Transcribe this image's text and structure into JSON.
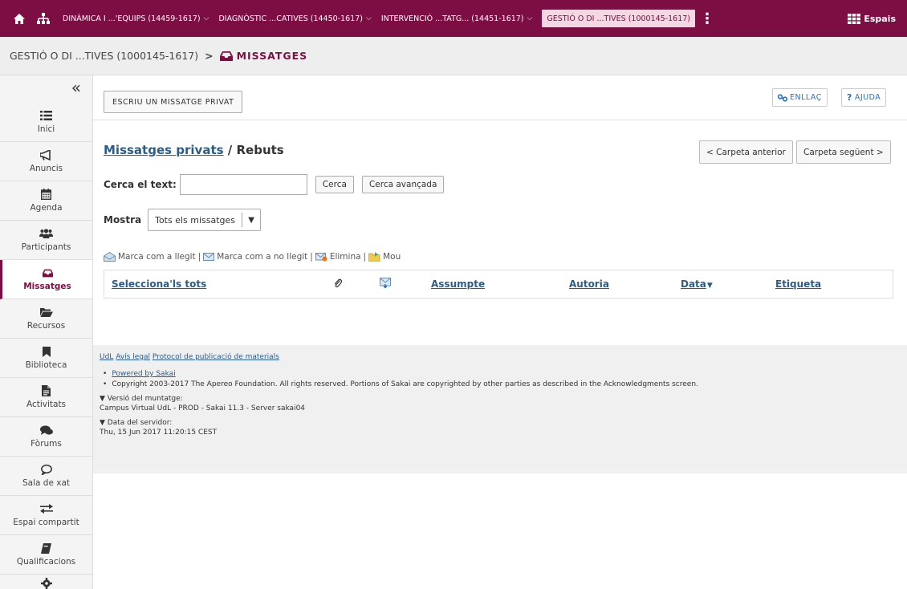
{
  "topbar": {
    "sites": [
      {
        "label": "DINÀMICA I ...'EQUIPS (14459-1617)",
        "current": false
      },
      {
        "label": "DIAGNÒSTIC ...CATIVES (14450-1617)",
        "current": false
      },
      {
        "label": "INTERVENCIÓ ...TATG... (14451-1617)",
        "current": false
      },
      {
        "label": "GESTIÓ O DI ...TIVES (1000145-1617)",
        "current": true
      }
    ],
    "espais_label": "Espais"
  },
  "breadcrumb": {
    "site": "GESTIÓ O DI ...TIVES (1000145-1617)",
    "separator": ">",
    "tool": "MISSATGES"
  },
  "sidebar": {
    "collapse_glyph": "«",
    "items": [
      {
        "label": "Inici",
        "icon": "list-icon",
        "active": false
      },
      {
        "label": "Anuncis",
        "icon": "megaphone-icon",
        "active": false
      },
      {
        "label": "Agenda",
        "icon": "calendar-icon",
        "active": false
      },
      {
        "label": "Participants",
        "icon": "users-icon",
        "active": false
      },
      {
        "label": "Missatges",
        "icon": "inbox-icon",
        "active": true
      },
      {
        "label": "Recursos",
        "icon": "folder-icon",
        "active": false
      },
      {
        "label": "Biblioteca",
        "icon": "bookmark-icon",
        "active": false
      },
      {
        "label": "Activitats",
        "icon": "file-icon",
        "active": false
      },
      {
        "label": "Fòrums",
        "icon": "comments-icon",
        "active": false
      },
      {
        "label": "Sala de xat",
        "icon": "chat-icon",
        "active": false
      },
      {
        "label": "Espai compartit",
        "icon": "exchange-icon",
        "active": false
      },
      {
        "label": "Qualificacions",
        "icon": "book-icon",
        "active": false
      }
    ]
  },
  "toolbar": {
    "write_label": "ESCRIU UN MISSATGE PRIVAT",
    "link_label": "ENLLAÇ",
    "help_label": "AJUDA"
  },
  "main": {
    "title_link": "Missatges privats",
    "title_rest": " / Rebuts",
    "prev_folder": "< Carpeta anterior",
    "next_folder": "Carpeta següent >",
    "search_label": "Cerca el text:",
    "search_value": "",
    "search_button": "Cerca",
    "advanced_button": "Cerca avançada",
    "show_label": "Mostra",
    "show_value": "Tots els missatges",
    "actions": {
      "mark_read": "Marca com a llegit",
      "mark_unread": "Marca com a no llegit",
      "delete": "Elimina",
      "move": "Mou",
      "separator": "|"
    },
    "table_headers": {
      "select_all": "Selecciona'ls tots",
      "subject": "Assumpte",
      "author": "Autoria",
      "date": "Data",
      "label": "Etiqueta"
    }
  },
  "footer": {
    "links": [
      "UdL",
      "Avís legal",
      "Protocol de publicació de materials"
    ],
    "powered": "Powered by Sakai",
    "copyright": "Copyright 2003-2017 The Apereo Foundation. All rights reserved. Portions of Sakai are copyrighted by other parties as described in the Acknowledgments screen.",
    "build_label": "▼ Versió del muntatge:",
    "build_value": "Campus Virtual UdL - PROD - Sakai 11.3 - Server sakai04",
    "server_label": "▼ Data del servidor:",
    "server_value": "Thu, 15 Jun 2017 11:20:15 CEST"
  },
  "colors": {
    "brand": "#7d0e43",
    "link": "#2b5d8a",
    "link_button": "#2a6fc4"
  }
}
